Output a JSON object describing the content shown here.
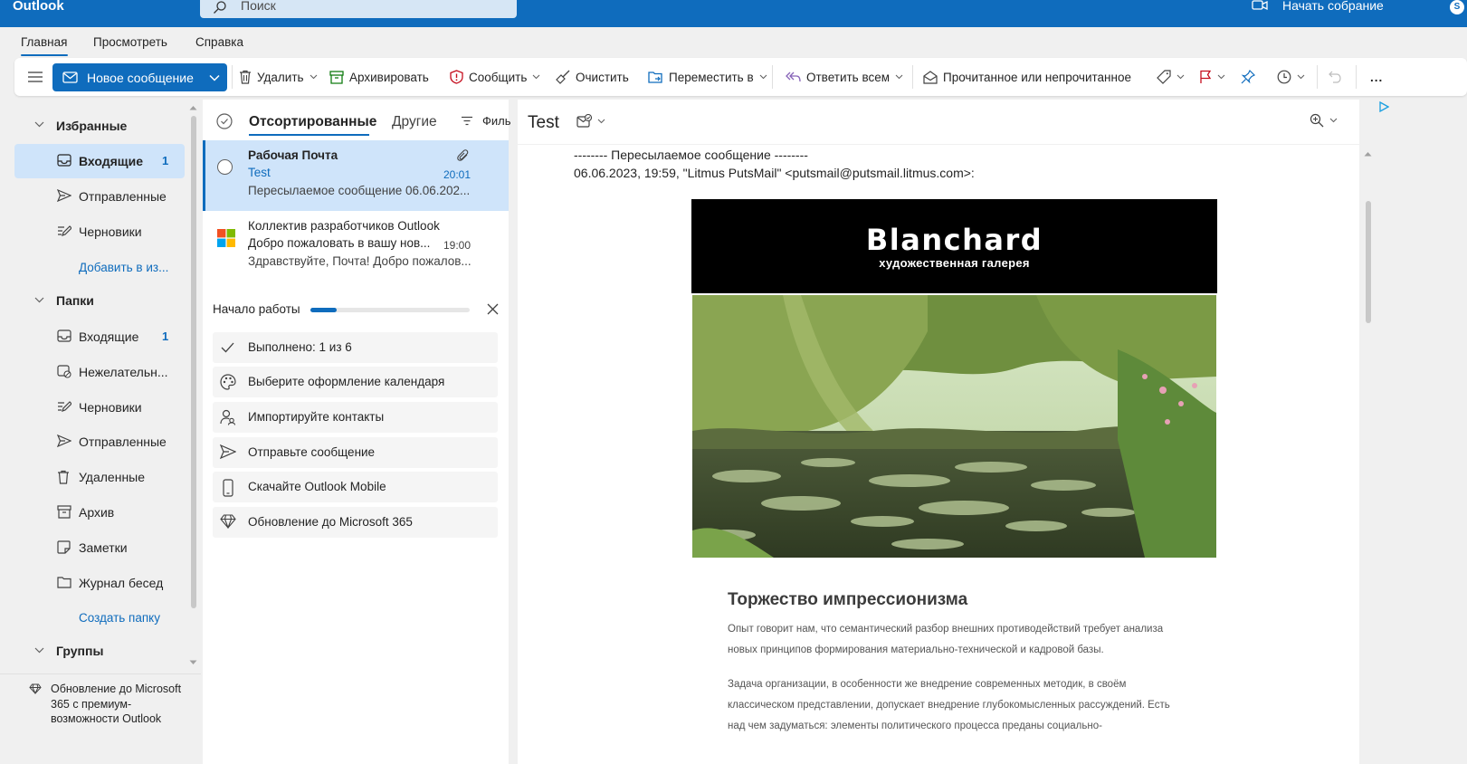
{
  "topbar": {
    "app_name": "Outlook",
    "search_placeholder": "Поиск",
    "meeting_label": "Начать собрание",
    "avatar_initial": "S"
  },
  "menu": {
    "tabs": [
      "Главная",
      "Просмотреть",
      "Справка"
    ]
  },
  "ribbon": {
    "new_message": "Новое сообщение",
    "delete": "Удалить",
    "archive": "Архивировать",
    "report": "Сообщить",
    "sweep": "Очистить",
    "move_to": "Переместить в",
    "reply_all": "Ответить всем",
    "read_unread": "Прочитанное или непрочитанное",
    "more": "..."
  },
  "sidebar": {
    "favorites_title": "Избранные",
    "favorites": [
      {
        "label": "Входящие",
        "count": "1",
        "icon": "inbox-icon"
      },
      {
        "label": "Отправленные",
        "count": "",
        "icon": "send-icon"
      },
      {
        "label": "Черновики",
        "count": "",
        "icon": "draft-icon"
      }
    ],
    "add_favorite": "Добавить в из...",
    "folders_title": "Папки",
    "folders": [
      {
        "label": "Входящие",
        "count": "1",
        "icon": "inbox-icon"
      },
      {
        "label": "Нежелательн...",
        "count": "",
        "icon": "junk-icon"
      },
      {
        "label": "Черновики",
        "count": "",
        "icon": "draft-icon"
      },
      {
        "label": "Отправленные",
        "count": "",
        "icon": "send-icon"
      },
      {
        "label": "Удаленные",
        "count": "",
        "icon": "trash-icon"
      },
      {
        "label": "Архив",
        "count": "",
        "icon": "archive-icon"
      },
      {
        "label": "Заметки",
        "count": "",
        "icon": "note-icon"
      },
      {
        "label": "Журнал бесед",
        "count": "",
        "icon": "folder-icon"
      }
    ],
    "create_folder": "Создать папку",
    "groups_title": "Группы",
    "upgrade_text": "Обновление до Microsoft 365 с премиум-возможности Outlook"
  },
  "message_list": {
    "tab_focused": "Отсортированные",
    "tab_other": "Другие",
    "filter": "Филь",
    "messages": [
      {
        "from": "Рабочая Почта",
        "subject": "Test",
        "time": "20:01",
        "preview": "Пересылаемое сообщение 06.06.202..."
      },
      {
        "from": "Коллектив разработчиков Outlook",
        "subject": "Добро пожаловать в вашу нов...",
        "time": "19:00",
        "preview": "Здравствуйте, Почта! Добро пожалов..."
      }
    ]
  },
  "getting_started": {
    "title": "Начало работы",
    "progress": 0.1667,
    "items": [
      {
        "label": "Выполнено: 1 из 6",
        "icon": "checkmark-icon"
      },
      {
        "label": "Выберите оформление календаря",
        "icon": "palette-icon"
      },
      {
        "label": "Импортируйте контакты",
        "icon": "people-icon"
      },
      {
        "label": "Отправьте сообщение",
        "icon": "send-icon"
      },
      {
        "label": "Скачайте Outlook Mobile",
        "icon": "phone-icon"
      },
      {
        "label": "Обновление до Microsoft 365",
        "icon": "diamond-icon"
      }
    ]
  },
  "reading_pane": {
    "title": "Test",
    "fwd_header": "-------- Пересылаемое сообщение --------",
    "fwd_meta": "06.06.2023, 19:59, \"Litmus PutsMail\" <putsmail@putsmail.litmus.com>:",
    "banner_title": "Blanchard",
    "banner_subtitle": "художественная галерея",
    "article_title": "Торжество импрессионизма",
    "article_p1_l1": "Опыт говорит нам, что семантический разбор внешних противодействий требует анализа",
    "article_p1_l2": "новых принципов формирования материально-технической и кадровой базы.",
    "article_p2_l1": "Задача организации, в особенности же внедрение современных методик, в своём",
    "article_p2_l2": "классическом представлении, допускает внедрение глубокомысленных рассуждений. Есть",
    "article_p2_l3": "над чем задуматься: элементы политического процесса преданы социально-"
  },
  "colors": {
    "accent": "#0f6cbd",
    "selected": "#cfe4fa",
    "flag": "#c50f1f",
    "report": "#c50f1f"
  }
}
